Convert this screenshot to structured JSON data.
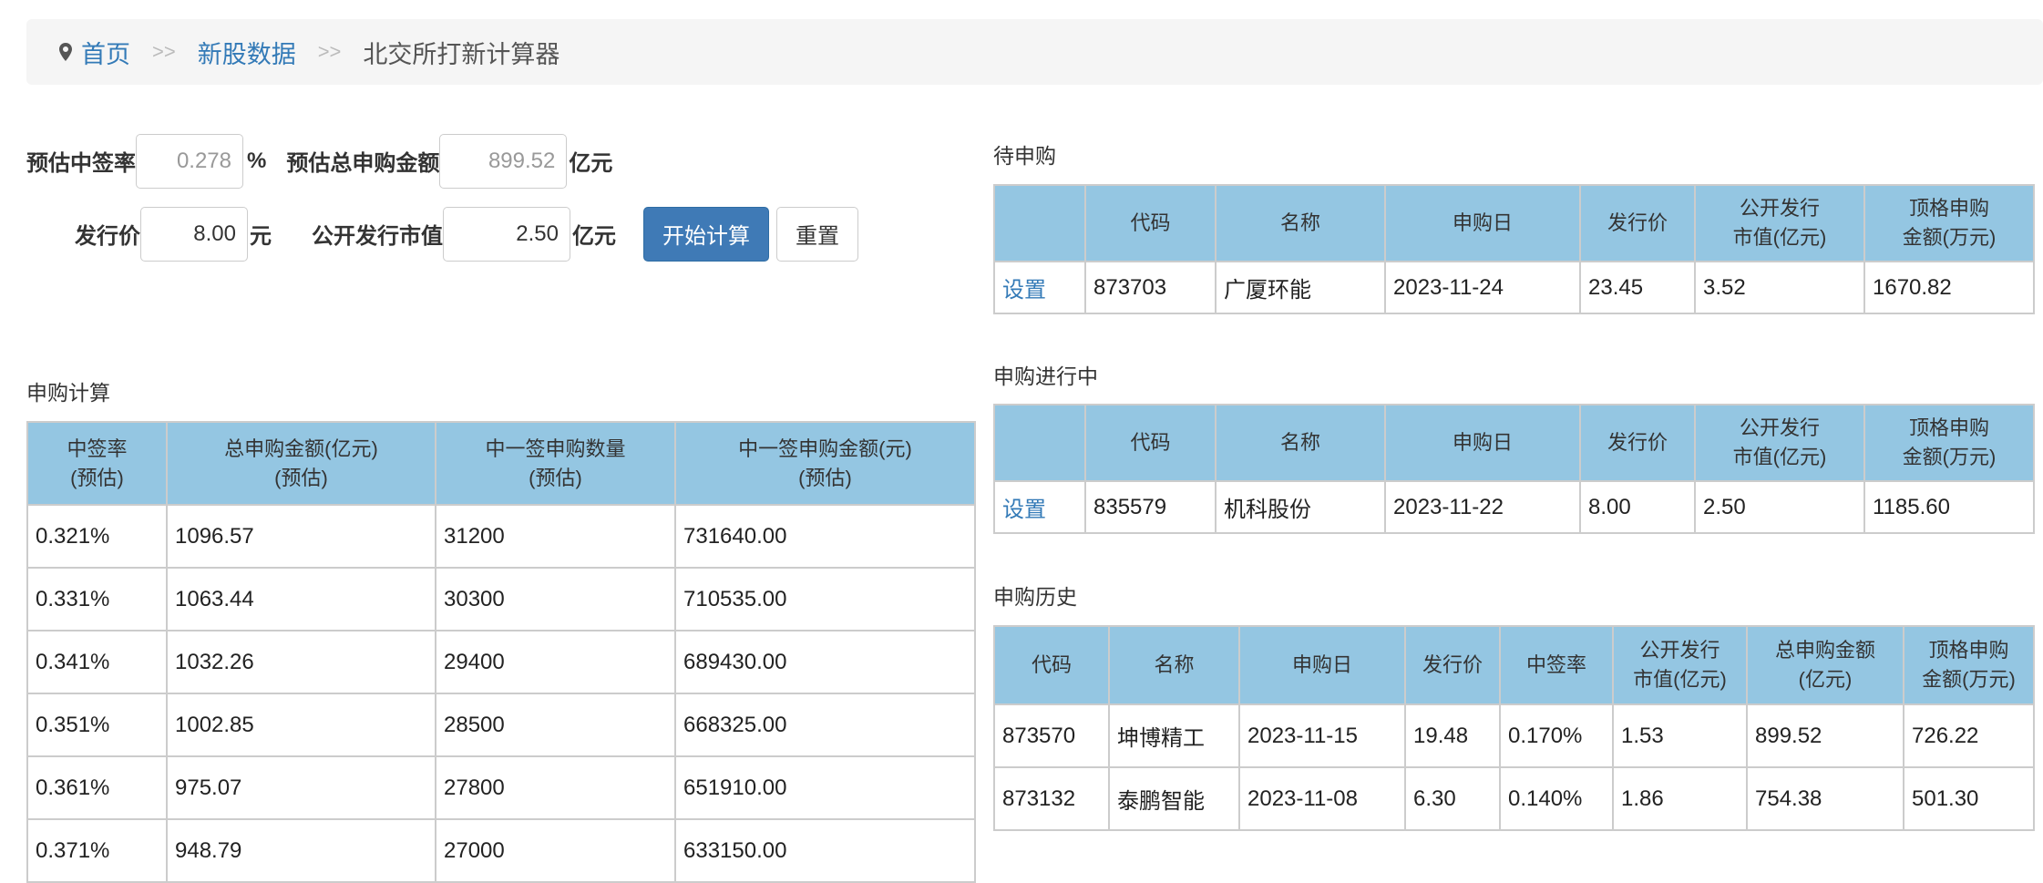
{
  "breadcrumb": {
    "home": "首页",
    "sep": ">>",
    "section": "新股数据",
    "current": "北交所打新计算器"
  },
  "form": {
    "rate_label": "预估中签率",
    "rate_value": "0.278",
    "rate_unit": "%",
    "total_label": "预估总申购金额",
    "total_value": "899.52",
    "total_unit": "亿元",
    "price_label": "发行价",
    "price_value": "8.00",
    "price_unit": "元",
    "cap_label": "公开发行市值",
    "cap_value": "2.50",
    "cap_unit": "亿元",
    "calc_button": "开始计算",
    "reset_button": "重置"
  },
  "calc": {
    "title": "申购计算",
    "headers": [
      [
        "中签率",
        "(预估)"
      ],
      [
        "总申购金额(亿元)",
        "(预估)"
      ],
      [
        "中一签申购数量",
        "(预估)"
      ],
      [
        "中一签申购金额(元)",
        "(预估)"
      ]
    ],
    "rows": [
      [
        "0.321%",
        "1096.57",
        "31200",
        "731640.00"
      ],
      [
        "0.331%",
        "1063.44",
        "30300",
        "710535.00"
      ],
      [
        "0.341%",
        "1032.26",
        "29400",
        "689430.00"
      ],
      [
        "0.351%",
        "1002.85",
        "28500",
        "668325.00"
      ],
      [
        "0.361%",
        "975.07",
        "27800",
        "651910.00"
      ],
      [
        "0.371%",
        "948.79",
        "27000",
        "633150.00"
      ]
    ]
  },
  "pending": {
    "title": "待申购",
    "headers": [
      [
        "",
        ""
      ],
      [
        "代码",
        ""
      ],
      [
        "名称",
        ""
      ],
      [
        "申购日",
        ""
      ],
      [
        "发行价",
        ""
      ],
      [
        "公开发行",
        "市值(亿元)"
      ],
      [
        "顶格申购",
        "金额(万元)"
      ]
    ],
    "rows": [
      [
        "设置",
        "873703",
        "广厦环能",
        "2023-11-24",
        "23.45",
        "3.52",
        "1670.82"
      ]
    ]
  },
  "ongoing": {
    "title": "申购进行中",
    "headers": [
      [
        "",
        ""
      ],
      [
        "代码",
        ""
      ],
      [
        "名称",
        ""
      ],
      [
        "申购日",
        ""
      ],
      [
        "发行价",
        ""
      ],
      [
        "公开发行",
        "市值(亿元)"
      ],
      [
        "顶格申购",
        "金额(万元)"
      ]
    ],
    "rows": [
      [
        "设置",
        "835579",
        "机科股份",
        "2023-11-22",
        "8.00",
        "2.50",
        "1185.60"
      ]
    ]
  },
  "history": {
    "title": "申购历史",
    "headers": [
      [
        "代码",
        ""
      ],
      [
        "名称",
        ""
      ],
      [
        "申购日",
        ""
      ],
      [
        "发行价",
        ""
      ],
      [
        "中签率",
        ""
      ],
      [
        "公开发行",
        "市值(亿元)"
      ],
      [
        "总申购金额",
        "(亿元)"
      ],
      [
        "顶格申购",
        "金额(万元)"
      ]
    ],
    "rows": [
      [
        "873570",
        "坤博精工",
        "2023-11-15",
        "19.48",
        "0.170%",
        "1.53",
        "899.52",
        "726.22"
      ],
      [
        "873132",
        "泰鹏智能",
        "2023-11-08",
        "6.30",
        "0.140%",
        "1.86",
        "754.38",
        "501.30"
      ]
    ]
  }
}
